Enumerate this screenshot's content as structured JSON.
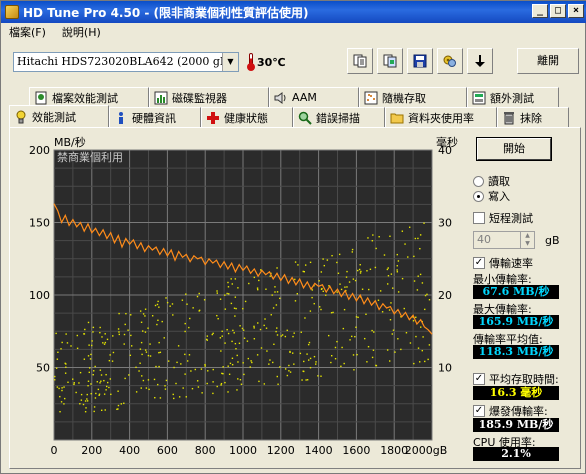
{
  "window": {
    "title": "HD Tune Pro 4.50 - (限非商業個利性質評估使用)",
    "controls": [
      "_",
      "□",
      "×"
    ]
  },
  "menu": {
    "items": [
      "檔案(F)",
      "說明(H)"
    ]
  },
  "toolbar": {
    "drive": "Hitachi HDS723020BLA642 (2000 gB)",
    "temperature": "30℃",
    "icons": [
      "copy-info-icon",
      "copy-screenshot-icon",
      "save-icon",
      "options-icon",
      "download-icon"
    ],
    "exit_label": "離開"
  },
  "tabs": {
    "row1": [
      {
        "label": "檔案效能測試",
        "icon": "file-bench-icon"
      },
      {
        "label": "磁碟監視器",
        "icon": "disk-monitor-icon"
      },
      {
        "label": "AAM",
        "icon": "speaker-icon"
      },
      {
        "label": "隨機存取",
        "icon": "random-access-icon"
      },
      {
        "label": "額外測試",
        "icon": "extra-tests-icon"
      }
    ],
    "row2": [
      {
        "label": "效能測試",
        "icon": "benchmark-icon",
        "active": true
      },
      {
        "label": "硬體資訊",
        "icon": "info-icon"
      },
      {
        "label": "健康狀態",
        "icon": "health-icon"
      },
      {
        "label": "錯誤掃描",
        "icon": "error-scan-icon"
      },
      {
        "label": "資料夾使用率",
        "icon": "folder-icon"
      },
      {
        "label": "抹除",
        "icon": "erase-icon"
      }
    ]
  },
  "controls": {
    "start_label": "開始",
    "read_label": "讀取",
    "write_label": "寫入",
    "mode_selected": "write",
    "short_test_label": "短程測試",
    "short_test_checked": false,
    "short_test_value": "40",
    "short_test_unit": "gB",
    "transfer_rate_label": "傳輸速率",
    "transfer_rate_checked": true,
    "min_label": "最小傳輸率:",
    "min_value": "67.6 MB/秒",
    "max_label": "最大傳輸率:",
    "max_value": "165.9 MB/秒",
    "avg_label": "傳輸率平均值:",
    "avg_value": "118.3 MB/秒",
    "access_label": "平均存取時間:",
    "access_checked": true,
    "access_value": "16.3 毫秒",
    "burst_label": "爆發傳輸率:",
    "burst_checked": true,
    "burst_value": "185.9 MB/秒",
    "cpu_label": "CPU 使用率:",
    "cpu_value": "2.1%"
  },
  "chart_data": {
    "type": "line",
    "watermark": "禁商業個利用",
    "y_left_unit": "MB/秒",
    "y_right_unit": "毫秒",
    "x_unit": "gB",
    "xlim": [
      0,
      2000
    ],
    "ylim_left": [
      0,
      200
    ],
    "ylim_right": [
      0,
      40
    ],
    "x_ticks": [
      "0",
      "200",
      "400",
      "600",
      "800",
      "1000",
      "1200",
      "1400",
      "1600",
      "1800",
      "2000gB"
    ],
    "y_left_ticks": [
      "200",
      "150",
      "100",
      "50"
    ],
    "y_right_ticks": [
      "40",
      "30",
      "20",
      "10"
    ],
    "grid": true,
    "series": [
      {
        "color": "#ff8c1a",
        "x": [
          0,
          20,
          40,
          60,
          80,
          100,
          120,
          140,
          160,
          180,
          200,
          220,
          240,
          260,
          280,
          300,
          320,
          340,
          360,
          380,
          400,
          420,
          440,
          460,
          480,
          500,
          520,
          540,
          560,
          580,
          600,
          620,
          640,
          660,
          680,
          700,
          720,
          740,
          760,
          780,
          800,
          820,
          840,
          860,
          880,
          900,
          920,
          940,
          960,
          980,
          1000,
          1020,
          1040,
          1060,
          1080,
          1100,
          1120,
          1140,
          1160,
          1180,
          1200,
          1220,
          1240,
          1260,
          1280,
          1300,
          1320,
          1340,
          1360,
          1380,
          1400,
          1420,
          1440,
          1460,
          1480,
          1500,
          1520,
          1540,
          1560,
          1580,
          1600,
          1620,
          1640,
          1660,
          1680,
          1700,
          1720,
          1740,
          1760,
          1780,
          1800,
          1820,
          1840,
          1860,
          1880,
          1900,
          1920,
          1940,
          1960,
          1980,
          2000
        ],
        "values": [
          163,
          158,
          150,
          155,
          148,
          152,
          147,
          150,
          144,
          149,
          143,
          146,
          141,
          145,
          139,
          143,
          136,
          141,
          133,
          139,
          135,
          138,
          132,
          136,
          130,
          134,
          131,
          133,
          128,
          132,
          127,
          131,
          124,
          130,
          126,
          128,
          123,
          127,
          125,
          126,
          121,
          125,
          122,
          124,
          119,
          123,
          118,
          122,
          116,
          121,
          117,
          120,
          115,
          118,
          113,
          117,
          114,
          116,
          111,
          115,
          110,
          114,
          108,
          112,
          107,
          111,
          105,
          109,
          104,
          108,
          106,
          107,
          102,
          106,
          101,
          104,
          99,
          103,
          97,
          101,
          96,
          100,
          94,
          98,
          93,
          96,
          90,
          94,
          91,
          92,
          87,
          90,
          85,
          88,
          83,
          86,
          80,
          83,
          78,
          76,
          73
        ]
      },
      {
        "color": "#e6e600",
        "point_style": "scatter",
        "values_ms_range": [
          6,
          26
        ],
        "mean_ms": 16.3
      }
    ]
  }
}
